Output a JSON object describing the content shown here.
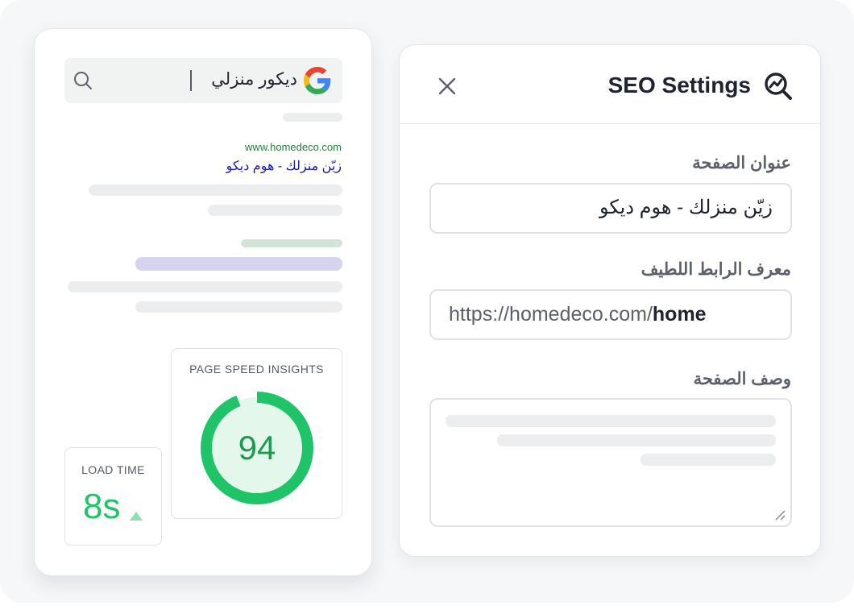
{
  "search_preview": {
    "query": "ديكور منزلي",
    "result_url": "www.homedeco.com",
    "result_title": "زيّن منزلك - هوم ديكو",
    "icons": {
      "search": "search-icon",
      "brand": "google-logo-icon"
    },
    "page_speed": {
      "title": "PAGE SPEED INSIGHTS",
      "score": "94",
      "score_fraction": 0.94,
      "color": "#1ec467"
    },
    "load_time": {
      "title": "LOAD TIME",
      "value": "8s",
      "trend_icon": "triangle-up-icon"
    }
  },
  "seo_settings": {
    "title": "SEO Settings",
    "icons": {
      "close": "close-icon",
      "logo": "magnifier-chart-icon",
      "resize": "resize-handle-icon"
    },
    "fields": {
      "page_title": {
        "label": "عنوان الصفحة",
        "value": "زيّن منزلك - هوم ديكو"
      },
      "slug": {
        "label": "معرف الرابط اللطيف",
        "prefix": "https://homedeco.com/",
        "value": "home"
      },
      "description": {
        "label": "وصف الصفحة",
        "value": ""
      }
    }
  },
  "colors": {
    "accent_green": "#1ec467",
    "link_blue": "#1a1aa6",
    "url_green": "#2a7d3e"
  }
}
